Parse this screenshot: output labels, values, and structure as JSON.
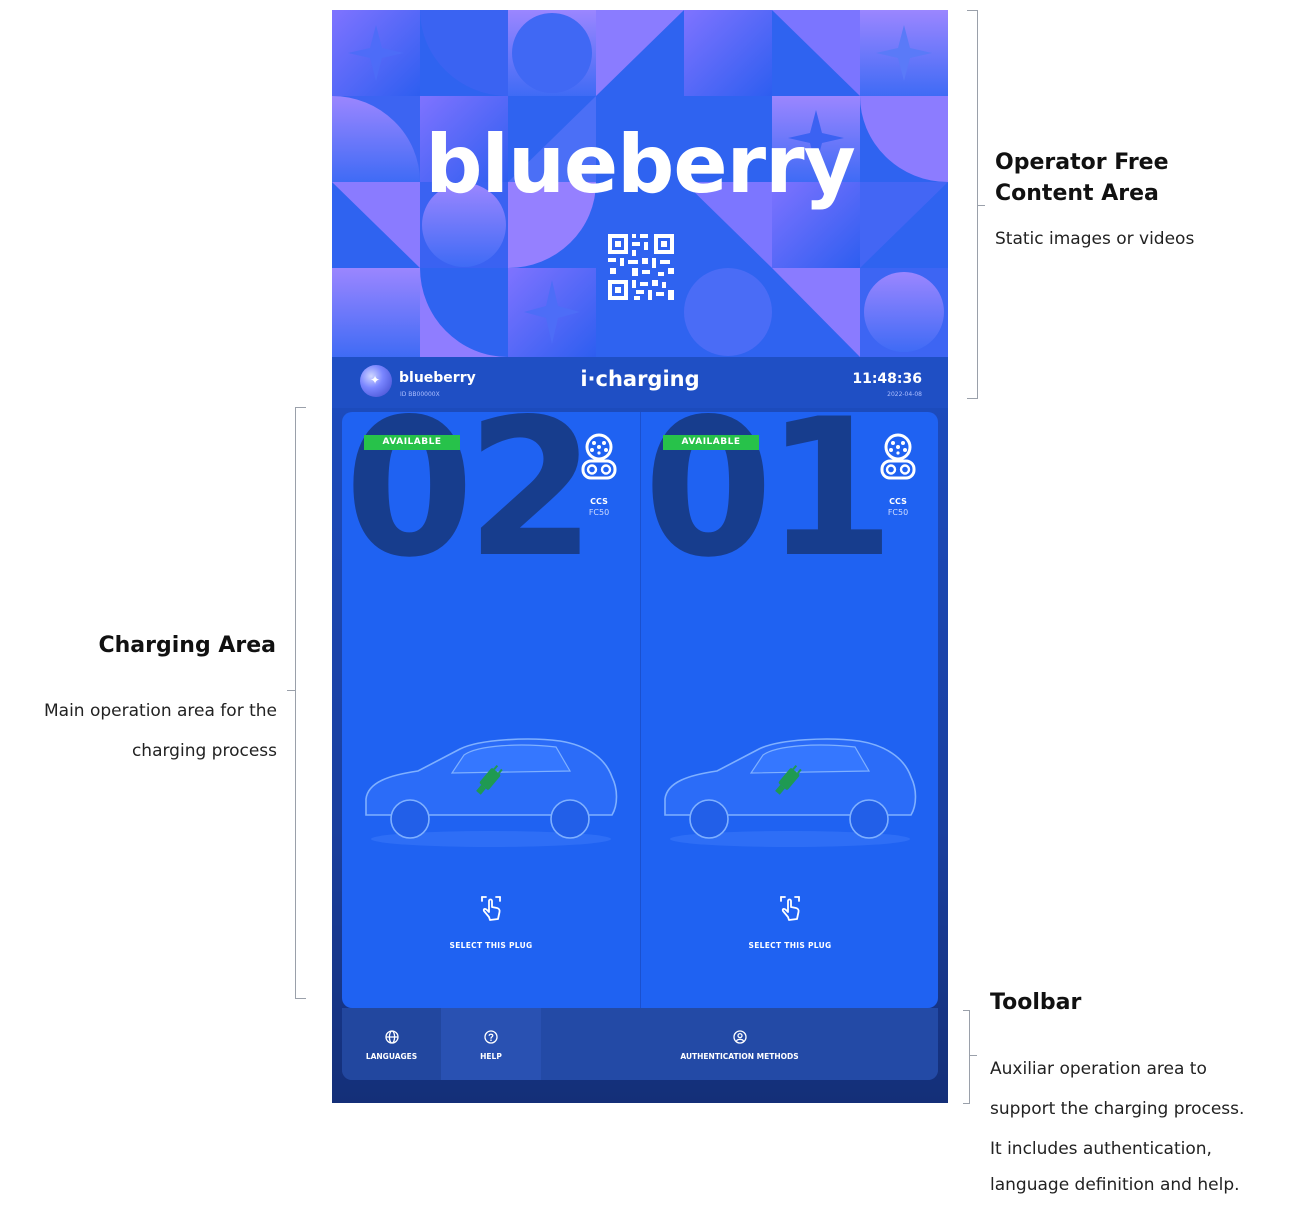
{
  "banner": {
    "brand": "blueberry",
    "qr_icon": "qr-code-icon"
  },
  "header": {
    "brand": "blueberry",
    "station_id": "ID BB00000X",
    "app_title": "i·charging",
    "time": "11:48:36",
    "date": "2022-04-08"
  },
  "plugs": [
    {
      "number": "02",
      "status": "AVAILABLE",
      "connector_type": "CCS",
      "connector_model": "FC50",
      "select_label": "SELECT THIS PLUG"
    },
    {
      "number": "01",
      "status": "AVAILABLE",
      "connector_type": "CCS",
      "connector_model": "FC50",
      "select_label": "SELECT THIS PLUG"
    }
  ],
  "toolbar": {
    "languages": "LANGUAGES",
    "help": "HELP",
    "authentication": "AUTHENTICATION METHODS"
  },
  "annotations": {
    "operator_title": "Operator Free Content Area",
    "operator_line1": "Operator Free",
    "operator_line2": "Content Area",
    "operator_body": "Static images or videos",
    "charging_title": "Charging Area",
    "charging_body_1": "Main operation area for the",
    "charging_body_2": "charging process",
    "toolbar_title": "Toolbar",
    "toolbar_body_1": "Auxiliar operation area to",
    "toolbar_body_2": "support the charging process.",
    "toolbar_body_3": "It includes authentication,",
    "toolbar_body_4": "language definition and help."
  },
  "colors": {
    "available": "#27c24a",
    "screen_blue": "#1f62f2",
    "banner_blue": "#2f63f0",
    "pattern_purple": "#8f7bff"
  }
}
